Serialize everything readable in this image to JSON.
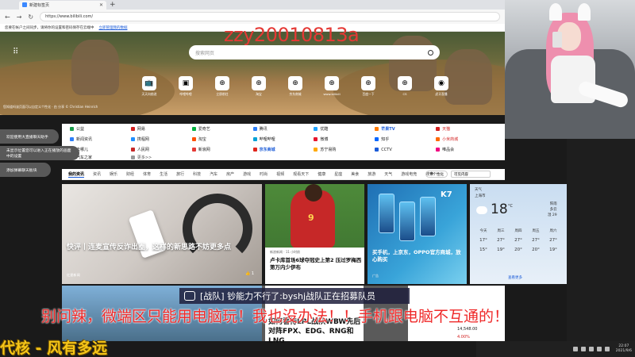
{
  "browser": {
    "tab_title": "新建标签页",
    "new_tab_symbol": "+",
    "url": "https://www.bilibili.com/",
    "infobar_text": "您要在帐户之间同步，请将你的设置和密码保存在云端中",
    "infobar_link": "立即管理我的数据"
  },
  "newtab": {
    "search_placeholder": "搜索网页",
    "quicklinks": [
      {
        "label": "天天向前进",
        "icon": "📺"
      },
      {
        "label": "哔哩哔哩",
        "icon": "▣"
      },
      {
        "label": "立即前往",
        "icon": "⊕"
      },
      {
        "label": "淘宝",
        "icon": "⊕"
      },
      {
        "label": "京东商城",
        "icon": "⊕"
      },
      {
        "label": "www.bilibili",
        "icon": "⊕"
      },
      {
        "label": "百度一下",
        "icon": "⊕"
      },
      {
        "label": "CS",
        "icon": "⊕"
      },
      {
        "label": "虎牙直播",
        "icon": "◉"
      }
    ],
    "photo_credit": "您知道吗该页面可以自定义个性化 · 由 分享 © Christian Heinrich"
  },
  "links": [
    {
      "label": "公益",
      "color": "#1a9c4a",
      "cls": ""
    },
    {
      "label": "网易",
      "color": "#d21f1f",
      "cls": ""
    },
    {
      "label": "爱奇艺",
      "color": "#00b140",
      "cls": ""
    },
    {
      "label": "腾讯",
      "color": "#2d7ff9",
      "cls": ""
    },
    {
      "label": "优酷",
      "color": "#1fa3ff",
      "cls": ""
    },
    {
      "label": "芒果TV",
      "color": "#ff7a00",
      "cls": "hl"
    },
    {
      "label": "天猫",
      "color": "#d21f1f",
      "cls": "red"
    },
    {
      "label": "新闻资讯",
      "color": "#2d7ff9",
      "cls": ""
    },
    {
      "label": "携程网",
      "color": "#1f8fff",
      "cls": ""
    },
    {
      "label": "淘宝",
      "color": "#ff5000",
      "cls": ""
    },
    {
      "label": "哔哩哔哩",
      "color": "#00a1d6",
      "cls": ""
    },
    {
      "label": "微博",
      "color": "#e6162d",
      "cls": ""
    },
    {
      "label": "知乎",
      "color": "#0066ff",
      "cls": ""
    },
    {
      "label": "小米商城",
      "color": "#ff6700",
      "cls": "red"
    },
    {
      "label": "去哪儿",
      "color": "#00bcd4",
      "cls": ""
    },
    {
      "label": "人民网",
      "color": "#c62828",
      "cls": ""
    },
    {
      "label": "新浪网",
      "color": "#e53935",
      "cls": ""
    },
    {
      "label": "京东商城",
      "color": "#e1251b",
      "cls": "hl"
    },
    {
      "label": "苏宁易购",
      "color": "#ffaa00",
      "cls": ""
    },
    {
      "label": "CCTV",
      "color": "#1a5bd8",
      "cls": ""
    },
    {
      "label": "唯品会",
      "color": "#f10180",
      "cls": ""
    },
    {
      "label": "汽车之家",
      "color": "#1a9c4a",
      "cls": ""
    },
    {
      "label": "更多>>",
      "color": "#999999",
      "cls": "more"
    }
  ],
  "bubbles": [
    "欢迎使用大直播聊天助手",
    "未显示位置您可以进入正在播放的画面中的设置",
    "添加弹幕聊天板块"
  ],
  "feed": {
    "tabs": [
      "我的资讯",
      "资讯",
      "娱乐",
      "财经",
      "体育",
      "生活",
      "旅行",
      "科技",
      "汽车",
      "房产",
      "游戏",
      "时尚",
      "视频",
      "观看天下",
      "健康",
      "星座",
      "美食",
      "旅游",
      "天气",
      "游戏电竞",
      "搜索"
    ],
    "personalize": "个性化",
    "view_select": "可见内容"
  },
  "cards": {
    "main_title": "快评丨连麦宣传反诈出圈，这样的新思路不妨更多点",
    "main_source": "红星新闻",
    "main_likes": "1",
    "sport_source": "新浪新闻 · 11 小时前",
    "sport_title": "卢卡库首场6球夺冠史上第2 压过罗梅西第万内少伊布",
    "phone_title": "买手机，上京东，OPPO官方商城，放心购买",
    "phone_source": "广告",
    "phone_badge": "K7"
  },
  "weather": {
    "heading": "天气",
    "location": "上海市",
    "temp": "18",
    "unit": "°C",
    "side": [
      "阵雨",
      "多云",
      "湿 29"
    ],
    "days": [
      "今天",
      "周三",
      "周四",
      "周五",
      "周六"
    ],
    "highs": [
      "17°",
      "27°",
      "27°",
      "27°",
      "27°"
    ],
    "lows": [
      "15°",
      "19°",
      "20°",
      "20°",
      "19°"
    ],
    "more": "查看更多"
  },
  "lower": {
    "card_title": "如何看待LPL战队WBW先后对阵FPX、EDG、RNG和LNG",
    "stock": "14,548.00",
    "change": "4.00%"
  },
  "overlay": {
    "name": "zzy20010813a",
    "bilibar_text": "[战队] 钞能力不行了:byshj战队正在招募队员",
    "red_text": "别问辣，微端区只能用电脑玩！我也没办法！！手机跟电脑不互通的！",
    "gold_text": "代核 - 风有多远"
  },
  "taskbar": {
    "time": "22:07",
    "date": "2021/9/6"
  }
}
